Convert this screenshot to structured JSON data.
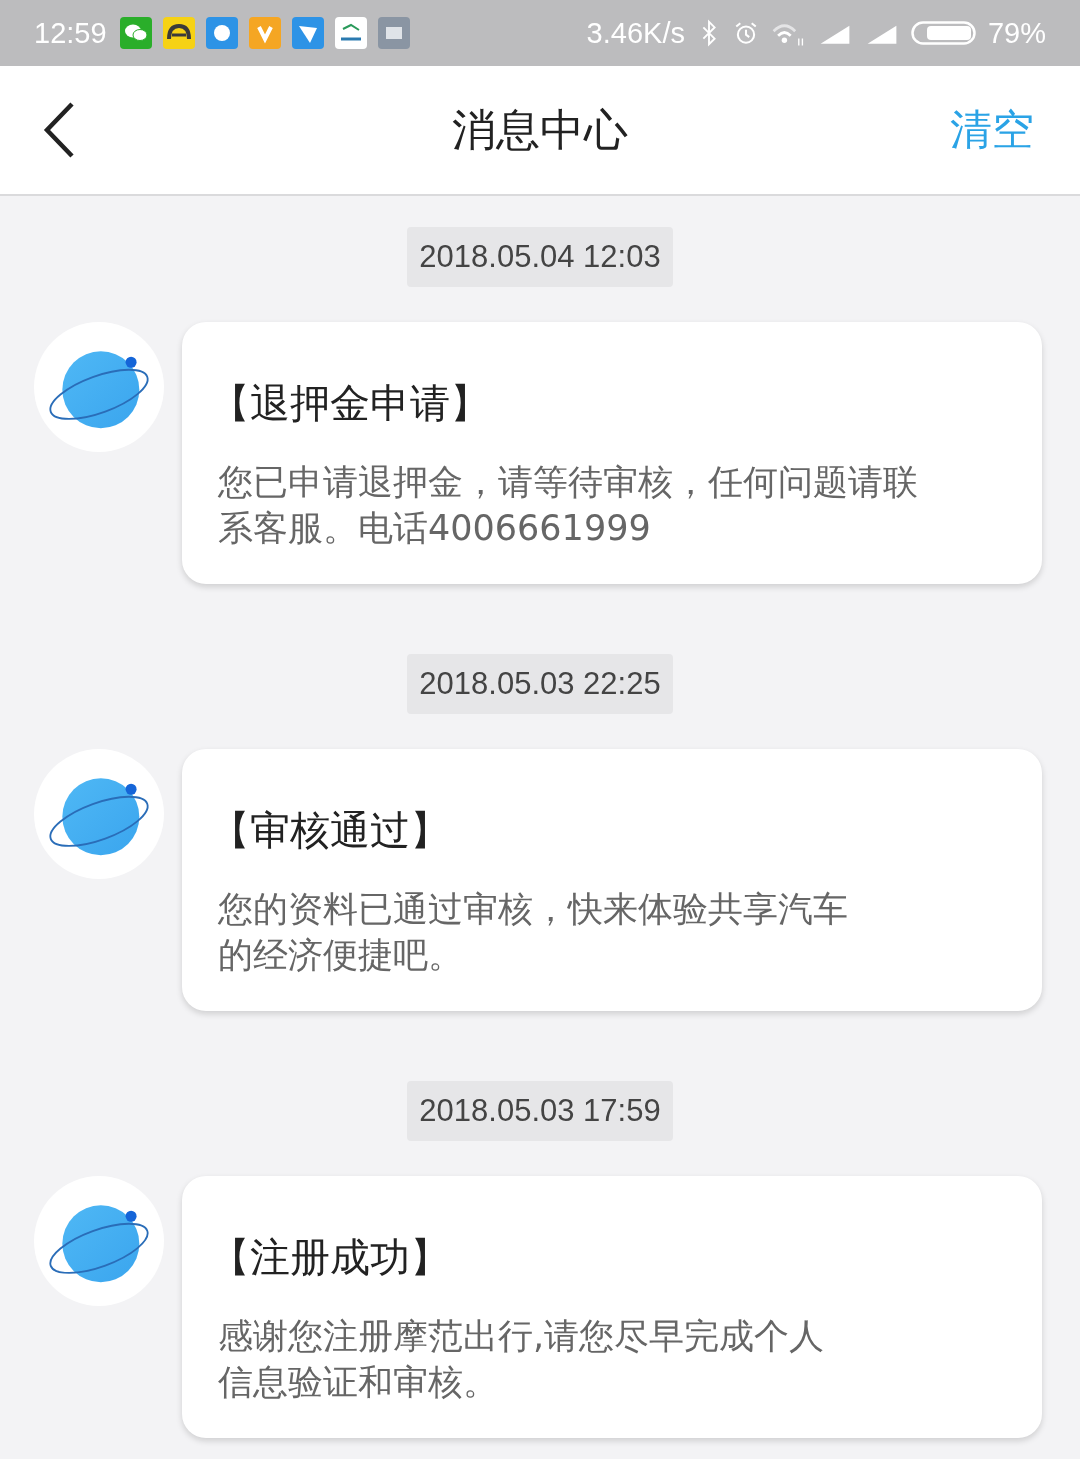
{
  "status_bar": {
    "time": "12:59",
    "network_speed": "3.46K/s",
    "battery": "79%"
  },
  "header": {
    "title": "消息中心",
    "action": "清空"
  },
  "messages": [
    {
      "timestamp": "2018.05.04 12:03",
      "title": "【退押金申请】",
      "body_lines": [
        "您已申请退押金，请等待审核，任何问题请联",
        "系客服。电话4006661999"
      ]
    },
    {
      "timestamp": "2018.05.03 22:25",
      "title": "【审核通过】",
      "body_lines": [
        "您的资料已通过审核，快来体验共享汽车",
        "的经济便捷吧。"
      ]
    },
    {
      "timestamp": "2018.05.03 17:59",
      "title": "【注册成功】",
      "body_lines": [
        "感谢您注册摩范出行,请您尽早完成个人",
        "信息验证和审核。"
      ]
    }
  ]
}
